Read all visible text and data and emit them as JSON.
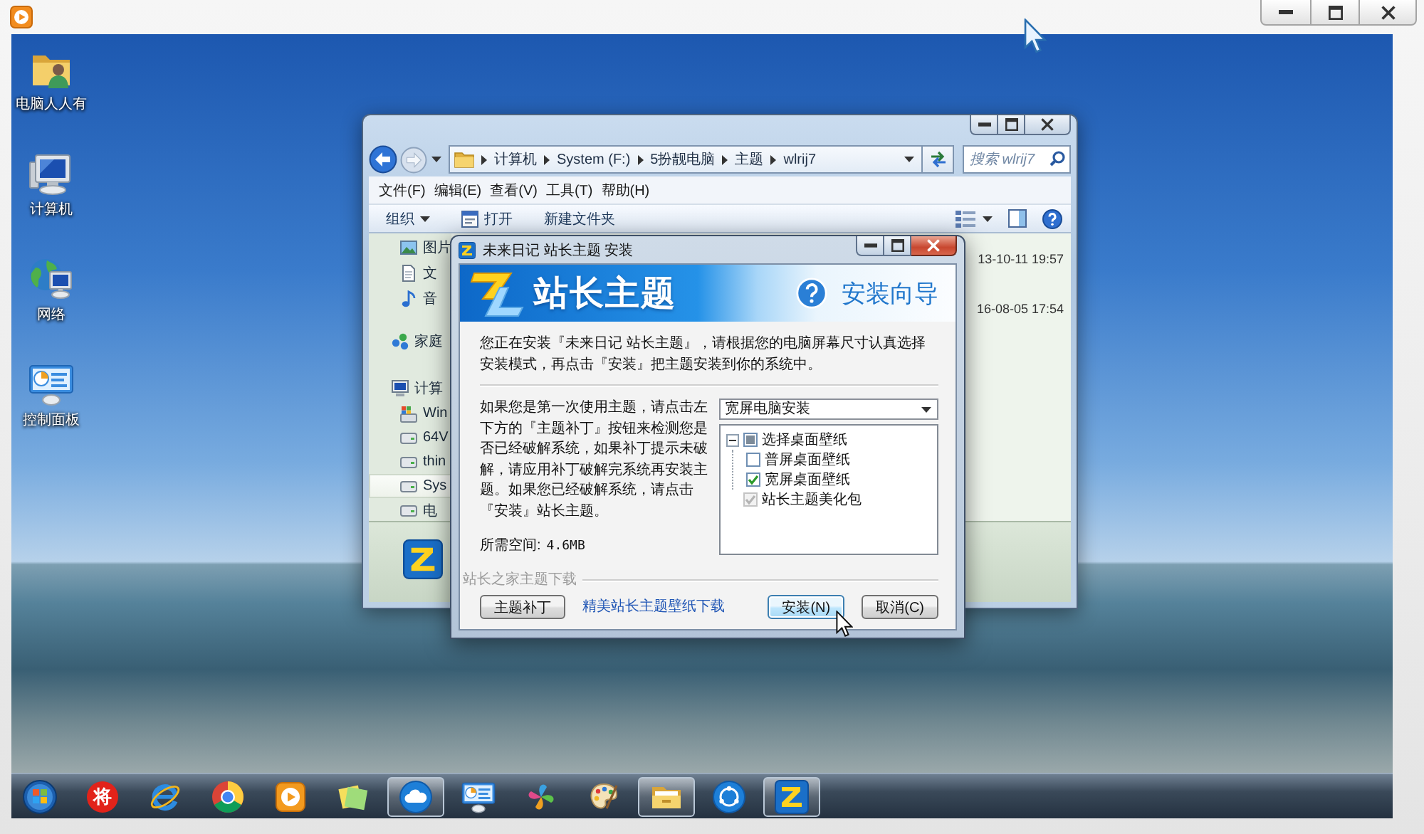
{
  "desktop_icons": [
    {
      "label": "电脑人人有",
      "kind": "user-folder"
    },
    {
      "label": "计算机",
      "kind": "computer"
    },
    {
      "label": "网络",
      "kind": "network"
    },
    {
      "label": "控制面板",
      "kind": "control-panel"
    }
  ],
  "explorer": {
    "breadcrumb": [
      "计算机",
      "System (F:)",
      "5扮靓电脑",
      "主题",
      "wlrij7"
    ],
    "search": {
      "placeholder": "搜索 wlrij7"
    },
    "menu": [
      "文件(F)",
      "编辑(E)",
      "查看(V)",
      "工具(T)",
      "帮助(H)"
    ],
    "toolbar": [
      {
        "label": "组织",
        "kind": "menu"
      },
      {
        "label": "打开",
        "kind": "open"
      },
      {
        "label": "新建文件夹",
        "kind": "plain"
      }
    ],
    "nav": {
      "libraries": [
        {
          "label": "图片",
          "kind": "pictures",
          "selected": false
        },
        {
          "label": "文",
          "kind": "documents",
          "selected": false
        },
        {
          "label": "音",
          "kind": "music",
          "selected": false
        }
      ],
      "homegroup": {
        "label": "家庭",
        "selected": false
      },
      "computer": {
        "label": "计算",
        "selected": false,
        "children": [
          {
            "label": "Win",
            "kind": "system-drive",
            "selected": false
          },
          {
            "label": "64V",
            "kind": "drive",
            "selected": false
          },
          {
            "label": "thin",
            "kind": "drive",
            "selected": false
          },
          {
            "label": "Sys",
            "kind": "drive",
            "selected": true
          },
          {
            "label": "电",
            "kind": "drive",
            "selected": false
          }
        ]
      }
    },
    "file_dates": [
      "13-10-11 19:57",
      "16-08-05 17:54"
    ]
  },
  "installer": {
    "title": "未来日记 站长主题 安装",
    "brand": "站长主题",
    "heading": "安装向导",
    "intro": "您正在安装『未来日记 站长主题』，请根据您的电脑屏幕尺寸认真选择安装模式，再点击『安装』把主题安装到你的系统中。",
    "description": "如果您是第一次使用主题，请点击左下方的『主题补丁』按钮来检测您是否已经破解系统，如果补丁提示未破解，请应用补丁破解完系统再安装主题。如果您已经破解系统，请点击『安装』站长主题。",
    "space": {
      "label": "所需空间:",
      "value": "4.6MB"
    },
    "mode": "宽屏电脑安装",
    "tree": [
      {
        "label": "选择桌面壁纸",
        "checked": false,
        "partial": true,
        "disabled": false,
        "expanded": true,
        "children": [
          {
            "label": "普屏桌面壁纸",
            "checked": false,
            "partial": false,
            "disabled": false
          },
          {
            "label": "宽屏桌面壁纸",
            "checked": true,
            "partial": false,
            "disabled": false
          }
        ]
      },
      {
        "label": "站长主题美化包",
        "checked": true,
        "partial": false,
        "disabled": true
      }
    ],
    "group_label": "站长之家主题下载",
    "patch_button": "主题补丁",
    "link": "精美站长主题壁纸下载",
    "buttons": [
      {
        "label": "安装(N)",
        "default": true
      },
      {
        "label": "取消(C)",
        "default": false
      }
    ]
  },
  "taskbar": {
    "items": [
      {
        "kind": "start",
        "active": false
      },
      {
        "kind": "seal",
        "text": "将",
        "active": false
      },
      {
        "kind": "swoosh",
        "active": false
      },
      {
        "kind": "tricolor",
        "active": false
      },
      {
        "kind": "media",
        "active": false
      },
      {
        "kind": "notes",
        "active": false
      },
      {
        "kind": "cloud",
        "active": true
      },
      {
        "kind": "dashboard",
        "active": false
      },
      {
        "kind": "pinwheel",
        "active": false
      },
      {
        "kind": "palette",
        "active": false
      },
      {
        "kind": "folder",
        "active": true
      },
      {
        "kind": "dots",
        "active": false
      },
      {
        "kind": "zlogo",
        "active": true
      }
    ]
  }
}
